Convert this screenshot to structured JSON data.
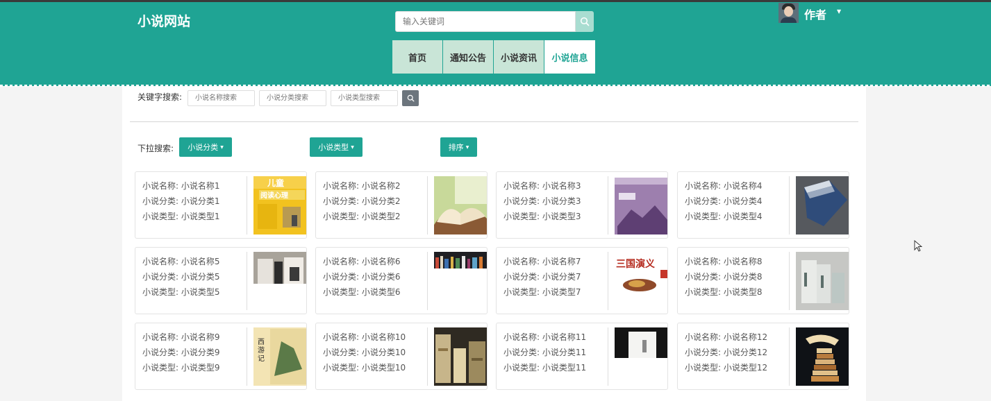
{
  "header": {
    "site_title": "小说网站",
    "search_placeholder": "输入关键词",
    "user_name": "作者"
  },
  "nav": [
    {
      "label": "首页"
    },
    {
      "label": "通知公告"
    },
    {
      "label": "小说资讯"
    },
    {
      "label": "小说信息",
      "active": true
    }
  ],
  "filters": {
    "keyword_label": "关键字搜索:",
    "name_placeholder": "小说名称搜索",
    "category_placeholder": "小说分类搜索",
    "type_placeholder": "小说类型搜索",
    "dropdown_label": "下拉搜索:",
    "category_dropdown": "小说分类",
    "type_dropdown": "小说类型",
    "sort_dropdown": "排序"
  },
  "cards": [
    {
      "name": "小说名称: 小说名称1",
      "category": "小说分类: 小说分类1",
      "type": "小说类型: 小说类型1",
      "cover": "children-reading-book-cover"
    },
    {
      "name": "小说名称: 小说名称2",
      "category": "小说分类: 小说分类2",
      "type": "小说类型: 小说类型2",
      "cover": "open-book-cover"
    },
    {
      "name": "小说名称: 小说名称3",
      "category": "小说分类: 小说分类3",
      "type": "小说类型: 小说类型3",
      "cover": "purple-book-cover"
    },
    {
      "name": "小说名称: 小说名称4",
      "category": "小说分类: 小说分类4",
      "type": "小说类型: 小说类型4",
      "cover": "blue-book-cover"
    },
    {
      "name": "小说名称: 小说名称5",
      "category": "小说分类: 小说分类5",
      "type": "小说类型: 小说类型5",
      "cover": "books-on-shelf-cover"
    },
    {
      "name": "小说名称: 小说名称6",
      "category": "小说分类: 小说分类6",
      "type": "小说类型: 小说类型6",
      "cover": "bookshelf-cover"
    },
    {
      "name": "小说名称: 小说名称7",
      "category": "小说分类: 小说分类7",
      "type": "小说类型: 小说类型7",
      "cover": "three-kingdoms-cover"
    },
    {
      "name": "小说名称: 小说名称8",
      "category": "小说分类: 小说分类8",
      "type": "小说类型: 小说类型8",
      "cover": "standing-books-cover"
    },
    {
      "name": "小说名称: 小说名称9",
      "category": "小说分类: 小说分类9",
      "type": "小说类型: 小说类型9",
      "cover": "journey-west-cover"
    },
    {
      "name": "小说名称: 小说名称10",
      "category": "小说分类: 小说分类10",
      "type": "小说类型: 小说类型10",
      "cover": "book-stacks-cover"
    },
    {
      "name": "小说名称: 小说名称11",
      "category": "小说分类: 小说分类11",
      "type": "小说类型: 小说类型11",
      "cover": "dark-book-cover"
    },
    {
      "name": "小说名称: 小说名称12",
      "category": "小说分类: 小说分类12",
      "type": "小说类型: 小说类型12",
      "cover": "book-tower-cover"
    }
  ],
  "colors": {
    "primary": "#1fa494",
    "nav_bg": "#c9e5d7",
    "search_btn": "#a9ddd1",
    "kw_btn": "#6c757d"
  }
}
